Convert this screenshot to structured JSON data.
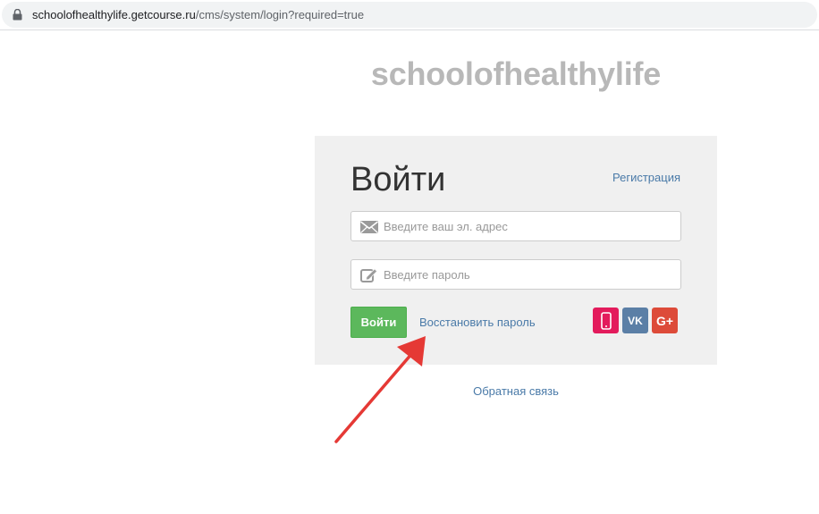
{
  "browser": {
    "url_domain": "schoolofhealthylife.getcourse.ru",
    "url_path": "/cms/system/login?required=true"
  },
  "site": {
    "title": "schoolofhealthylife"
  },
  "login": {
    "heading": "Войти",
    "register_link": "Регистрация",
    "email_placeholder": "Введите ваш эл. адрес",
    "password_placeholder": "Введите пароль",
    "submit_label": "Войти",
    "restore_link": "Восстановить пароль"
  },
  "social": {
    "vk_label": "VK",
    "gplus_label": "G+"
  },
  "footer": {
    "feedback_link": "Обратная связь"
  },
  "colors": {
    "accent_link": "#4a7aa8",
    "submit_green": "#5cb85c",
    "phone_pink": "#e31b5c",
    "vk_blue": "#5b7fa6",
    "gplus_red": "#dd4b39",
    "annotation_arrow": "#e53935"
  },
  "icons": [
    "lock-icon",
    "envelope-icon",
    "pencil-icon",
    "smartphone-icon",
    "vk-icon",
    "google-plus-icon",
    "arrow-annotation"
  ]
}
